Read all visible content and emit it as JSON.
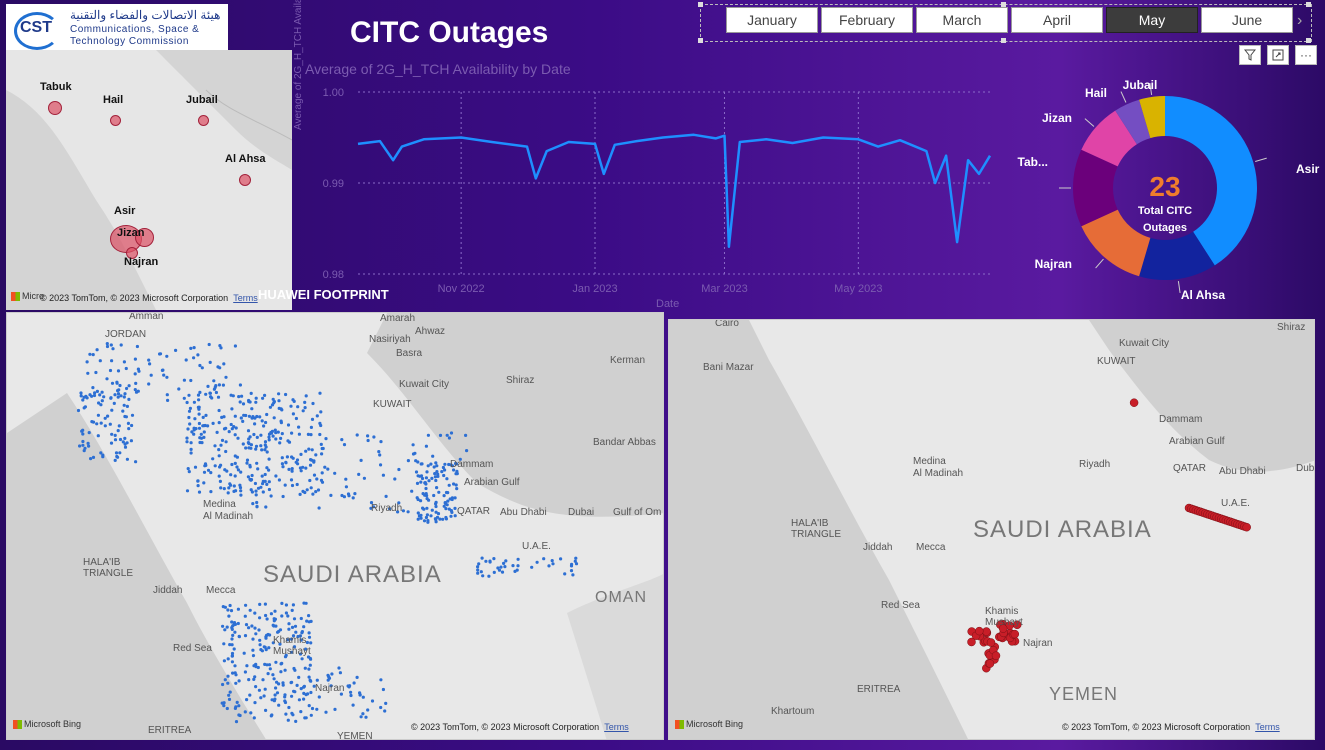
{
  "app": {
    "title": "CITC Outages",
    "logo_abbrev": "CST",
    "logo_arabic": "هيئة الاتصالات والفضاء والتقنية",
    "logo_line1": "Communications, Space &",
    "logo_line2": "Technology Commission"
  },
  "slicer": {
    "months": [
      "January",
      "February",
      "March",
      "April",
      "May",
      "June"
    ],
    "selected": "May"
  },
  "toolbar": {
    "filter_icon": "filter-icon",
    "focus_icon": "focus-mode-icon",
    "more_label": "···"
  },
  "minimap": {
    "labels": [
      "Tabuk",
      "Hail",
      "Jubail",
      "Al Ahsa",
      "Asir",
      "Jizan",
      "Najran"
    ],
    "credit": "© 2023 TomTom, © 2023 Microsoft Corporation",
    "terms": "Terms",
    "bing": "Micro"
  },
  "line_chart": {
    "title": "Average of 2G_H_TCH Availability by Date",
    "ylabel": "Average of 2G_H_TCH Availability",
    "xlabel": "Date",
    "yticks": [
      "1.00",
      "0.99",
      "0.98"
    ],
    "xticks": [
      "Nov 2022",
      "Jan 2023",
      "Mar 2023",
      "May 2023"
    ],
    "overlay": "HUAWEI FOOTPRINT"
  },
  "chart_data": {
    "type": "line",
    "title": "Average of 2G_H_TCH Availability by Date",
    "xlabel": "Date",
    "ylabel": "Average of 2G_H_TCH Availability",
    "ylim": [
      0.98,
      1.0
    ],
    "x_range": [
      "2022-09-15",
      "2023-06-30"
    ],
    "series": [
      {
        "color": "#1e8fff",
        "x": [
          "2022-09-15",
          "2022-09-25",
          "2022-10-01",
          "2022-10-05",
          "2022-10-15",
          "2022-11-01",
          "2022-11-15",
          "2022-12-01",
          "2022-12-05",
          "2022-12-10",
          "2022-12-20",
          "2023-01-01",
          "2023-01-05",
          "2023-01-10",
          "2023-01-20",
          "2023-02-01",
          "2023-02-15",
          "2023-02-25",
          "2023-03-01",
          "2023-03-03",
          "2023-03-08",
          "2023-03-20",
          "2023-04-01",
          "2023-04-15",
          "2023-05-01",
          "2023-05-10",
          "2023-05-20",
          "2023-06-01",
          "2023-06-05",
          "2023-06-10",
          "2023-06-15",
          "2023-06-20",
          "2023-06-25",
          "2023-06-30"
        ],
        "values": [
          0.9943,
          0.9946,
          0.9925,
          0.994,
          0.9948,
          0.995,
          0.9945,
          0.994,
          0.9905,
          0.9935,
          0.9945,
          0.9943,
          0.991,
          0.9942,
          0.9946,
          0.995,
          0.9953,
          0.9949,
          0.9952,
          0.983,
          0.9945,
          0.9948,
          0.9944,
          0.995,
          0.9948,
          0.994,
          0.9947,
          0.9935,
          0.99,
          0.993,
          0.9835,
          0.9925,
          0.991,
          0.993
        ]
      }
    ]
  },
  "donut": {
    "center_value": "23",
    "center_label_1": "Total CITC",
    "center_label_2": "Outages",
    "slices": [
      {
        "label": "Asir",
        "value": 9,
        "color": "#118dff"
      },
      {
        "label": "Al Ahsa",
        "value": 3,
        "color": "#12239e"
      },
      {
        "label": "Najran",
        "value": 3,
        "color": "#e66c37"
      },
      {
        "label": "Tab...",
        "value": 3,
        "color": "#6b007b"
      },
      {
        "label": "Jizan",
        "value": 2,
        "color": "#e044a7"
      },
      {
        "label": "Hail",
        "value": 1,
        "color": "#744ec2"
      },
      {
        "label": "Jubail",
        "value": 1,
        "color": "#d9b300"
      }
    ]
  },
  "map_left": {
    "country": "SAUDI ARABIA",
    "cities": [
      "Amman",
      "JORDAN",
      "Amarah",
      "Ahwaz",
      "Nasiriyah",
      "Basra",
      "Kerman",
      "Shiraz",
      "Kuwait City",
      "KUWAIT",
      "Bandar Abbas",
      "Dammam",
      "Arabian Gulf",
      "QATAR",
      "Abu Dhabi",
      "Dubai",
      "Gulf of Om",
      "U.A.E.",
      "OMAN",
      "Medina",
      "Al Madinah",
      "Riyadh",
      "HALA'IB TRIANGLE",
      "Jiddah",
      "Mecca",
      "Red Sea",
      "Khamis Mushayt",
      "Najran",
      "ERITREA",
      "YEMEN"
    ],
    "credit": "© 2023 TomTom, © 2023 Microsoft Corporation",
    "terms": "Terms",
    "bing": "Microsoft Bing"
  },
  "map_right": {
    "country": "SAUDI ARABIA",
    "cities": [
      "Cairo",
      "Shiraz",
      "Kuwait City",
      "KUWAIT",
      "Bani Mazar",
      "Dammam",
      "Arabian Gulf",
      "QATAR",
      "Abu Dhabi",
      "Dubai",
      "U.A.E.",
      "Medina",
      "Al Madinah",
      "Riyadh",
      "HALA'IB TRIANGLE",
      "Jiddah",
      "Mecca",
      "Red Sea",
      "Khamis Mushayt",
      "Najran",
      "ERITREA",
      "YEMEN",
      "Khartoum"
    ],
    "credit": "© 2023 TomTom, © 2023 Microsoft Corporation",
    "terms": "Terms",
    "bing": "Microsoft Bing"
  }
}
